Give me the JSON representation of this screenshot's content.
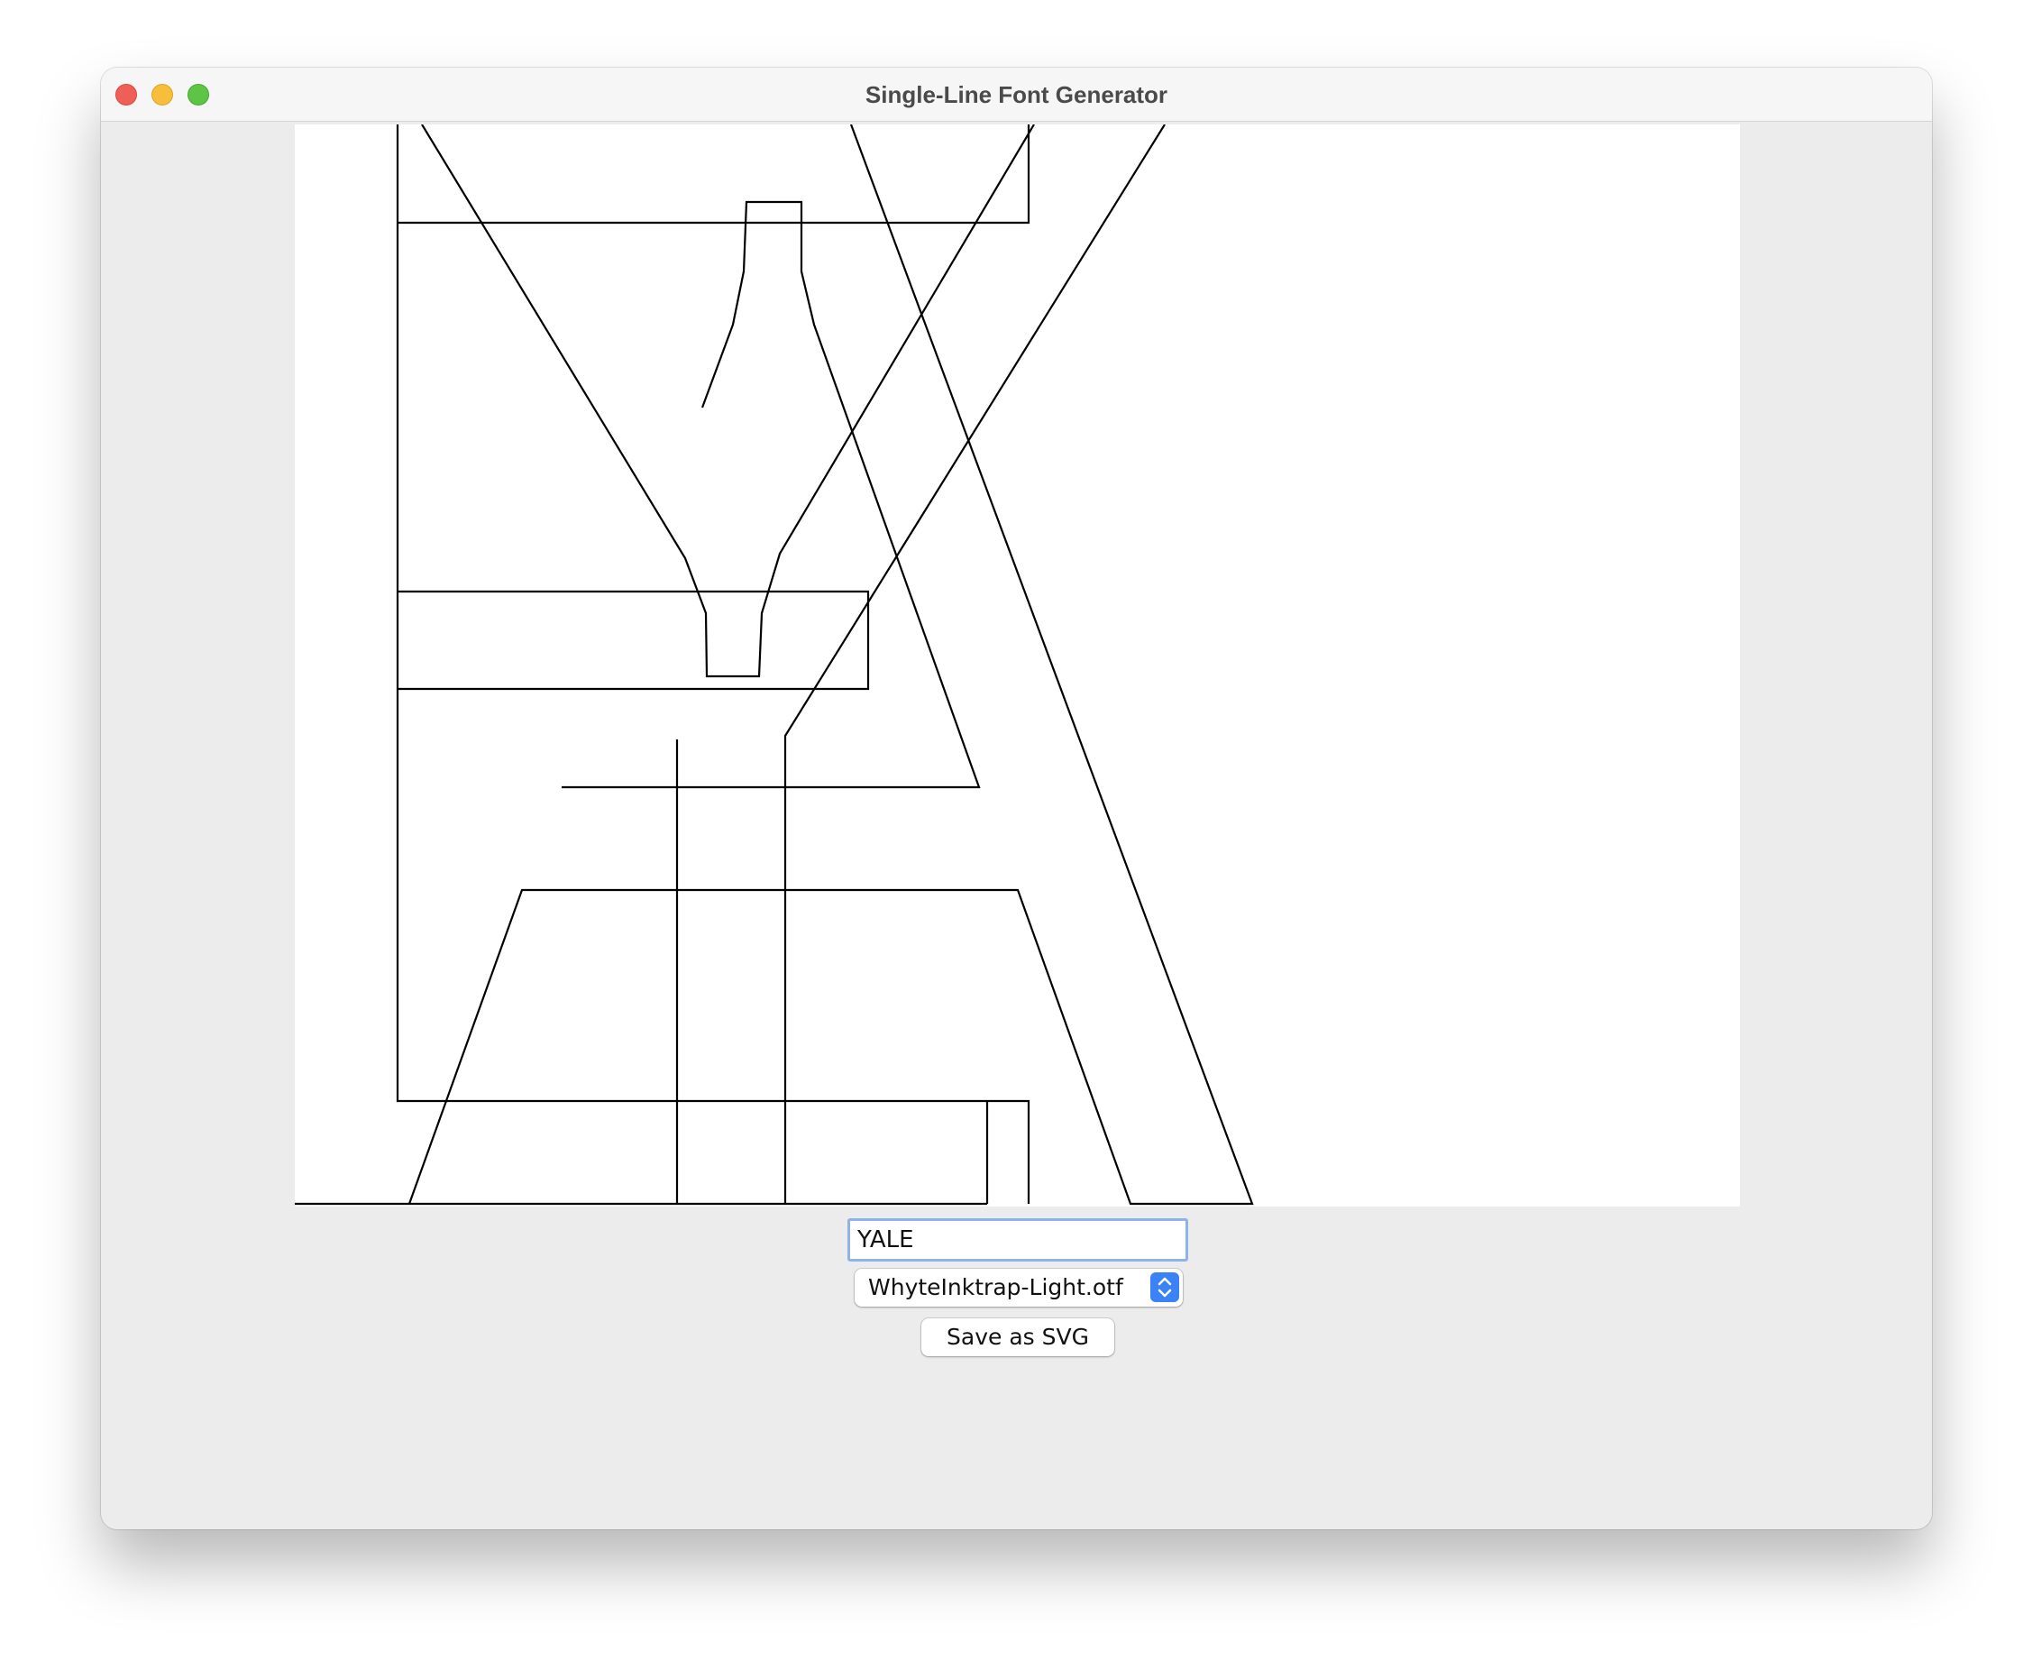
{
  "window": {
    "title": "Single-Line Font Generator"
  },
  "text_input": {
    "value": "YALE"
  },
  "font_select": {
    "selected": "WhyteInktrap-Light.otf"
  },
  "save_button": {
    "label": "Save as SVG"
  },
  "colors": {
    "window_background": "#ececec",
    "canvas_background": "#ffffff",
    "stroke": "#000000",
    "select_accent": "#3b82f6",
    "focus_ring": "#8fb2ea"
  },
  "icons": {
    "close": "close-icon",
    "minimize": "minimize-icon",
    "maximize": "maximize-icon",
    "select_arrows": "chevron-updown-icon"
  }
}
